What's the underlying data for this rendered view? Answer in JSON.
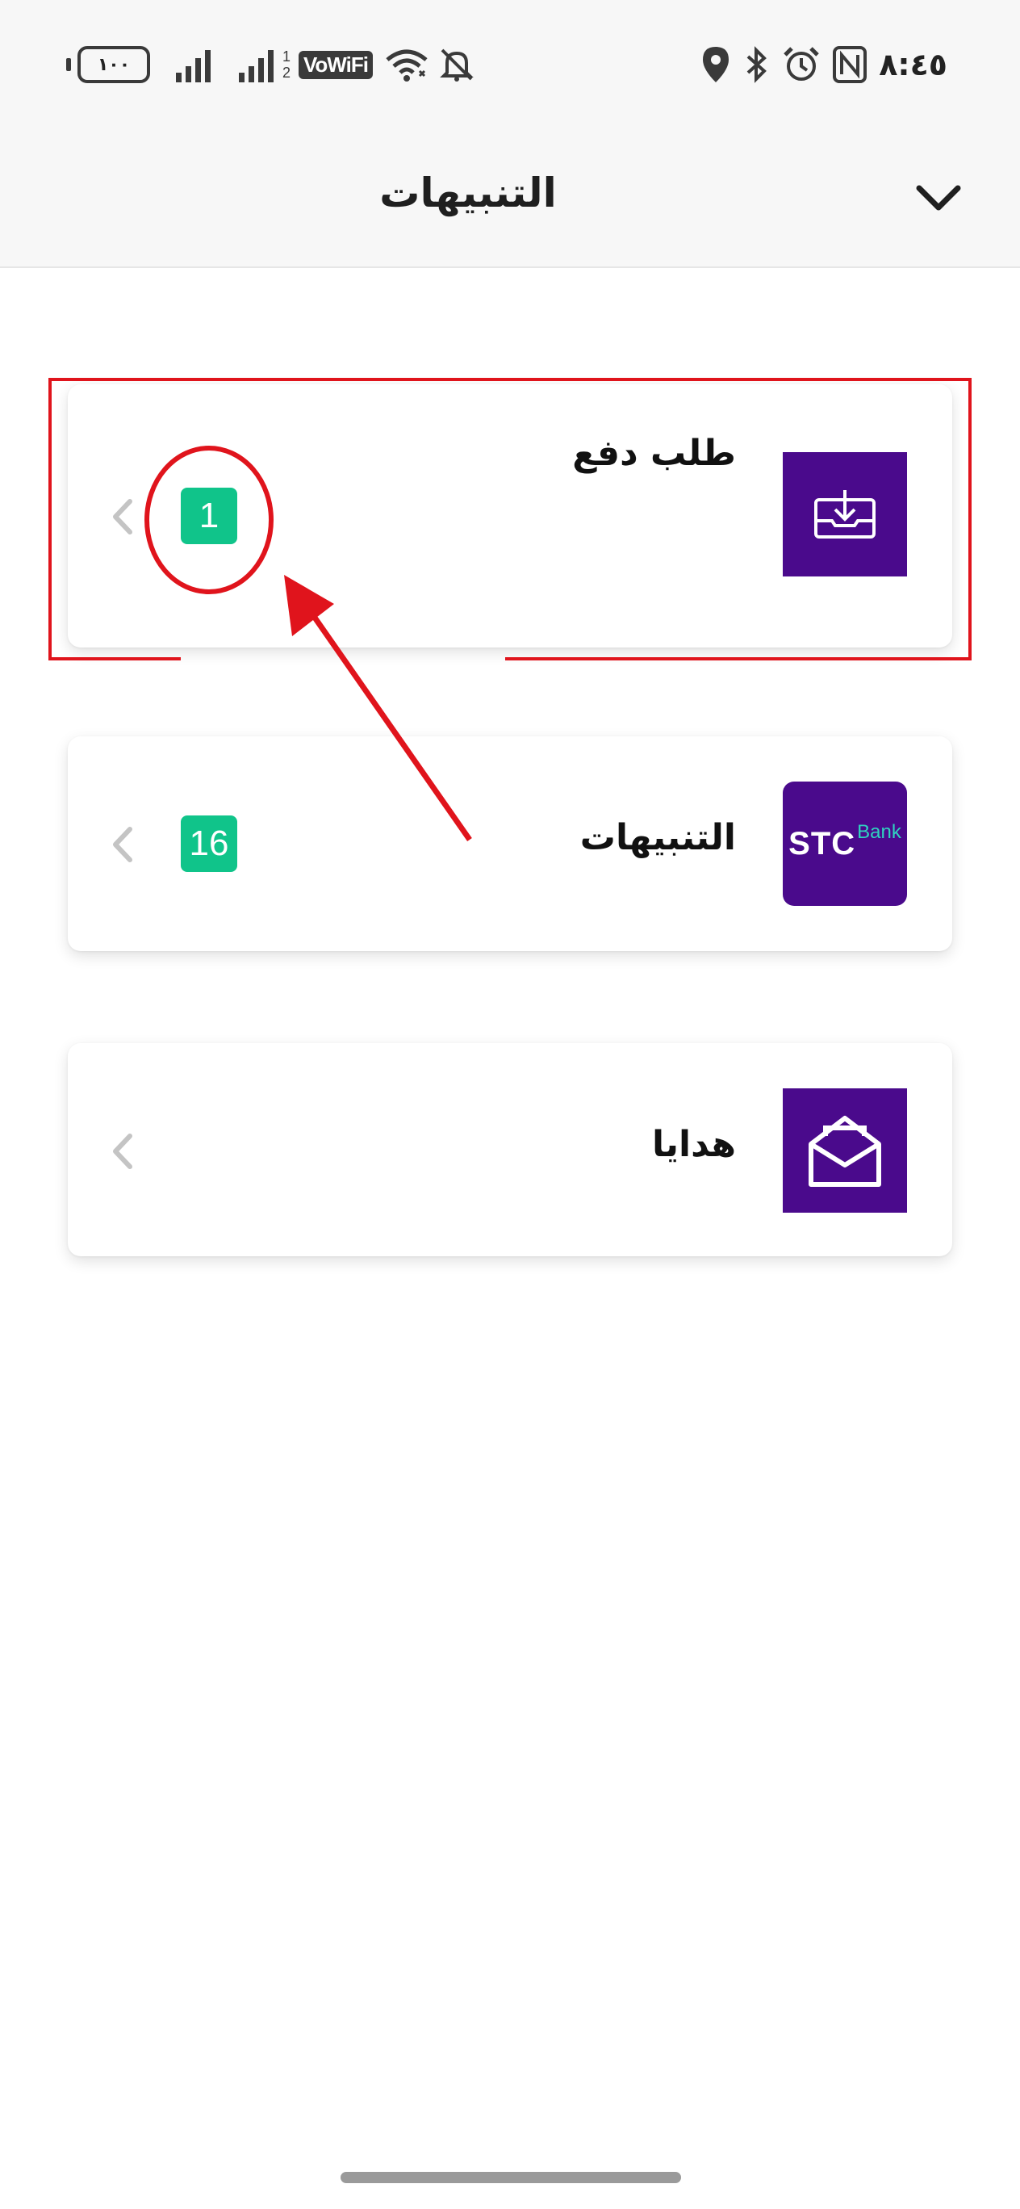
{
  "status_bar": {
    "battery_level": "١٠٠",
    "vowifi_label": "VoWiFi",
    "time": "٨:٤٥",
    "sim2_indicator_top": "1",
    "sim2_indicator_bottom": "2",
    "icons": [
      "battery-icon",
      "signal-icon",
      "signal-icon",
      "vowifi-icon",
      "wifi-icon",
      "bell-off-icon",
      "location-icon",
      "bluetooth-icon",
      "alarm-icon",
      "nfc-icon"
    ]
  },
  "header": {
    "title": "التنبيهات",
    "collapse_icon": "chevron-down-icon"
  },
  "notifications": [
    {
      "label": "طلب دفع",
      "icon": "download-tray-icon",
      "badge": "1"
    },
    {
      "label": "التنبيهات",
      "icon": "stc-bank-logo",
      "logo_text": "STC",
      "logo_subtext": "Bank",
      "badge": "16"
    },
    {
      "label": "هدايا",
      "icon": "envelope-open-icon",
      "badge": ""
    }
  ],
  "colors": {
    "brand_purple": "#4a0a8c",
    "badge_green": "#10c48a",
    "annotation_red": "#e0141c",
    "header_bg": "#f7f7f7",
    "bank_teal": "#2fd3c0"
  }
}
